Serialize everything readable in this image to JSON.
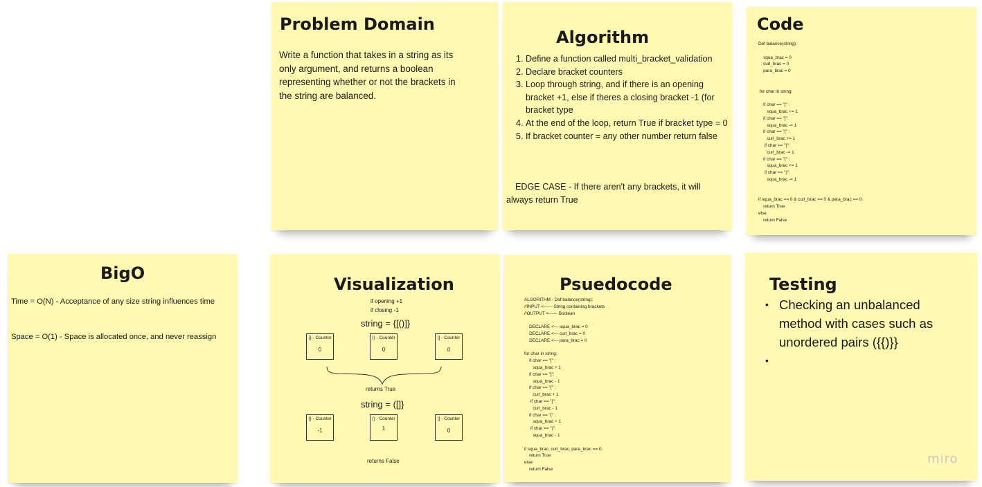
{
  "notes": {
    "problem_domain": {
      "title": "Problem Domain",
      "body": "Write a function that takes in a string as its only argument, and returns a boolean representing whether or not the brackets in the string are balanced."
    },
    "algorithm": {
      "title": "Algorithm",
      "steps": [
        "Define a function called multi_bracket_validation",
        "Declare bracket counters",
        "Loop through string, and if there is an opening bracket +1, else if theres a closing bracket -1 (for bracket type",
        "At the end of the loop, return True if bracket type = 0",
        "If bracket counter = any other number return false"
      ],
      "edge_case": "EDGE CASE - If there aren't any brackets, it will always return True"
    },
    "code": {
      "title": "Code",
      "body": "Def balance(string):\n\n    squa_brac = 0\n    curl_brac = 0\n    para_brac = 0\n\n\n for char in string:\n\n    if char == \"[\" :\n       squa_brac += 1\n    if char == \"]\":\n       squa_brac -= 1\n    if char == \"{\" :\n       curl_brac += 1\n     if char == \"}\":\n       curl_brac -= 1\n    if char == \"(\" :\n       squa_brac += 1\n     if char == \")\":\n       squa_brac -= 1\n\n\nif squa_brac == 0 & curl_brac == 0 & para_brac == 0:\n    return True\nelse:\n    return False"
    },
    "bigo": {
      "title": "BigO",
      "time": "Time = O(N) - Acceptance of any size string influences time",
      "space": "Space = O(1) - Space is allocated once, and never reassign"
    },
    "visualization": {
      "title": "Visualization",
      "rule_open": "if opening +1",
      "rule_close": "if closing -1",
      "example1": {
        "string": "string = {[()]}",
        "counters": [
          {
            "label": "{} - Counter",
            "value": "0"
          },
          {
            "label": "() - Counter",
            "value": "0"
          },
          {
            "label": "[] - Counter",
            "value": "0"
          }
        ],
        "result": "returns True"
      },
      "example2": {
        "string": "string = ([]}",
        "counters": [
          {
            "label": "{} - Counter",
            "value": "-1"
          },
          {
            "label": "() - Counter",
            "value": "1"
          },
          {
            "label": "[] - Counter",
            "value": "0"
          }
        ],
        "result": "returns False"
      }
    },
    "pseudocode": {
      "title": "Psuedocode",
      "body": "ALGORITHM - Def balance(string):\n//INPUT <------ String containing brackets\n//OUTPUT <------ Boolean\n\n    DECLARE <--- squa_brac = 0\n    DECLARE <--- curl_brac = 0\n    DECLARE <--- para_brac = 0\n\nfor char in string:\n    if char == \"[\" :\n       squa_brac + 1\n    if char == \"]\":\n       squa_brac - 1\n    if char == \"{\" :\n       curl_brac + 1\n     if char == \"}\":\n       curl_brac - 1\n    if char == \"(\" :\n       squa_brac + 1\n     if char == \")\":\n       squa_brac - 1\n\nif squa_brac, curl_brac, para_brac == 0:\n    return True\nelse:\n    return False"
    },
    "testing": {
      "title": "Testing",
      "items": [
        "Checking an unbalanced method with cases such as unordered pairs ({{)}}",
        ""
      ]
    }
  },
  "branding": {
    "logo": "miro"
  },
  "colors": {
    "note_yellow": "#fff9b1"
  }
}
